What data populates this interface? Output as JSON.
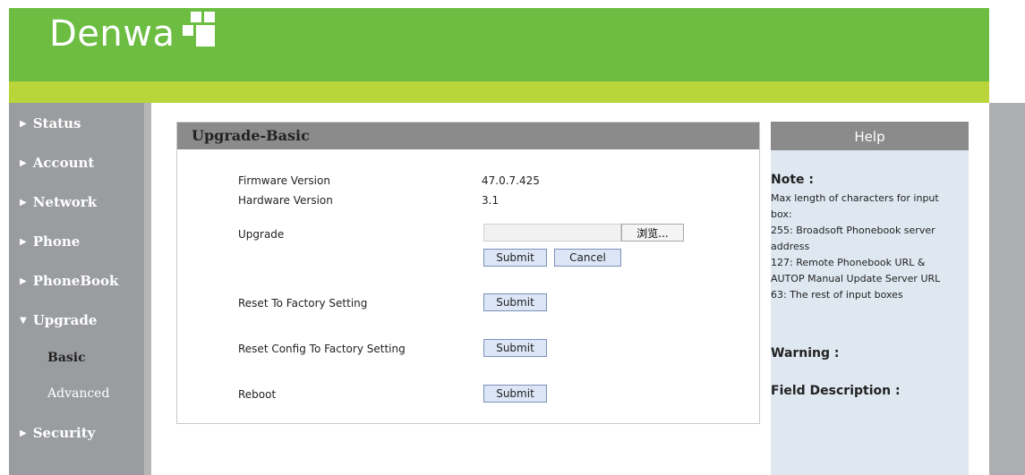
{
  "brand": {
    "logo_text": "Denwa",
    "header_color": "#6cbd42",
    "strip_color": "#b9d53a"
  },
  "sidebar": {
    "items": [
      {
        "label": "Status",
        "icon": "triangle-right-icon"
      },
      {
        "label": "Account",
        "icon": "triangle-right-icon"
      },
      {
        "label": "Network",
        "icon": "triangle-right-icon"
      },
      {
        "label": "Phone",
        "icon": "triangle-right-icon"
      },
      {
        "label": "PhoneBook",
        "icon": "triangle-right-icon"
      },
      {
        "label": "Upgrade",
        "icon": "triangle-down-icon",
        "expanded": true
      },
      {
        "label": "Security",
        "icon": "triangle-right-icon"
      }
    ],
    "subitems": [
      {
        "label": "Basic",
        "active": true
      },
      {
        "label": "Advanced",
        "active": false
      }
    ]
  },
  "panel": {
    "title": "Upgrade-Basic",
    "firmware_label": "Firmware Version",
    "firmware_value": "47.0.7.425",
    "hardware_label": "Hardware Version",
    "hardware_value": "3.1",
    "upgrade_label": "Upgrade",
    "browse_label": "浏览...",
    "submit_label": "Submit",
    "cancel_label": "Cancel",
    "reset_factory_label": "Reset To Factory Setting",
    "reset_config_label": "Reset Config To Factory Setting",
    "reboot_label": "Reboot"
  },
  "help": {
    "title": "Help",
    "note_heading": "Note :",
    "note_lines": [
      "Max length of characters for input",
      "box:",
      "255: Broadsoft Phonebook server",
      "address",
      "127: Remote Phonebook URL &",
      "AUTOP Manual Update Server URL",
      "63: The rest of input boxes"
    ],
    "warning_heading": "Warning :",
    "field_heading": "Field Description :"
  }
}
